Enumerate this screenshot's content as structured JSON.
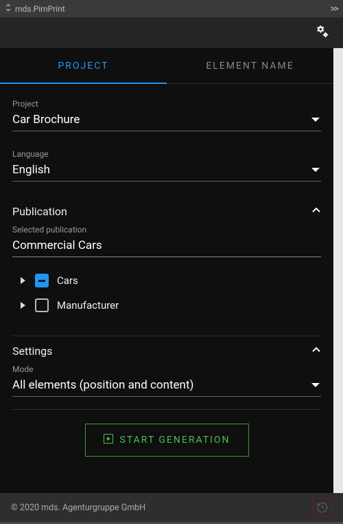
{
  "titlebar": {
    "title": "mds.PimPrint"
  },
  "tabs": {
    "project": "PROJECT",
    "element": "ELEMENT NAME"
  },
  "fields": {
    "project": {
      "label": "Project",
      "value": "Car Brochure"
    },
    "language": {
      "label": "Language",
      "value": "English"
    },
    "selected_pub": {
      "label": "Selected publication",
      "value": "Commercial Cars"
    },
    "mode": {
      "label": "Mode",
      "value": "All elements (position and content)"
    }
  },
  "sections": {
    "publication": "Publication",
    "settings": "Settings"
  },
  "tree": {
    "items": [
      {
        "label": "Cars",
        "state": "indeterminate"
      },
      {
        "label": "Manufacturer",
        "state": "unchecked"
      }
    ]
  },
  "actions": {
    "start": "START GENERATION"
  },
  "footer": {
    "copyright": "© 2020 mds. Agenturgruppe GmbH"
  }
}
